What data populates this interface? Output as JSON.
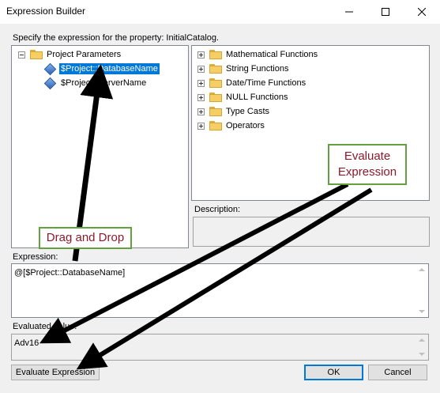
{
  "window": {
    "title": "Expression Builder"
  },
  "prompt": "Specify the expression for the property: InitialCatalog.",
  "left_tree": {
    "root": "Project Parameters",
    "items": [
      "$Project::DatabaseName",
      "$Project::ServerName"
    ]
  },
  "right_tree": {
    "items": [
      "Mathematical Functions",
      "String Functions",
      "Date/Time Functions",
      "NULL Functions",
      "Type Casts",
      "Operators"
    ]
  },
  "description": {
    "label": "Description:",
    "value": ""
  },
  "expression": {
    "label": "Expression:",
    "value": "@[$Project::DatabaseName]"
  },
  "evaluated": {
    "label": "Evaluated value:",
    "value": "Adv16"
  },
  "buttons": {
    "evaluate": "Evaluate Expression",
    "ok": "OK",
    "cancel": "Cancel"
  },
  "annotations": {
    "drag_drop": "Drag and Drop",
    "evaluate_line1": "Evaluate",
    "evaluate_line2": "Expression"
  },
  "colors": {
    "callout_border": "#62a23e",
    "callout_text": "#8b1a2b",
    "selection": "#0078d7",
    "arrow": "#000000"
  }
}
